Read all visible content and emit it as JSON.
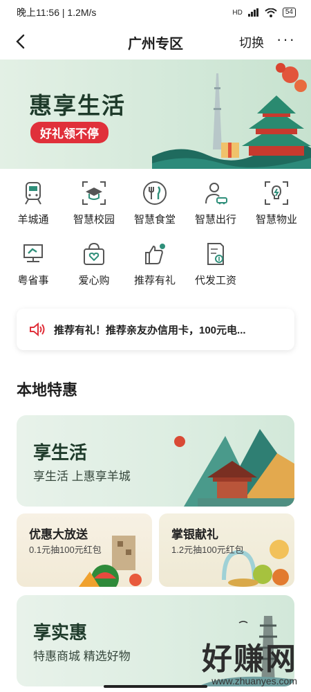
{
  "status": {
    "time": "晚上11:56",
    "speed": "1.2M/s",
    "network": "HD",
    "battery": "54"
  },
  "nav": {
    "title": "广州专区",
    "switch_label": "切换",
    "more_label": "···"
  },
  "banner": {
    "title": "惠享生活",
    "tag": "好礼领不停"
  },
  "grid": [
    {
      "label": "羊城通",
      "icon": "metro-icon"
    },
    {
      "label": "智慧校园",
      "icon": "graduation-cap-icon"
    },
    {
      "label": "智慧食堂",
      "icon": "fork-knife-icon"
    },
    {
      "label": "智慧出行",
      "icon": "person-car-icon"
    },
    {
      "label": "智慧物业",
      "icon": "lightbulb-icon"
    },
    {
      "label": "粤省事",
      "icon": "screen-icon"
    },
    {
      "label": "爱心购",
      "icon": "shopping-basket-heart-icon"
    },
    {
      "label": "推荐有礼",
      "icon": "thumbs-up-icon"
    },
    {
      "label": "代发工资",
      "icon": "payroll-document-icon"
    }
  ],
  "notice": {
    "text": "推荐有礼！推荐亲友办信用卡，100元电..."
  },
  "section": {
    "title": "本地特惠",
    "cards": {
      "life": {
        "title": "享生活",
        "subtitle": "享生活 上惠享羊城"
      },
      "discount": {
        "title": "优惠大放送",
        "subtitle": "0.1元抽100元红包"
      },
      "gift": {
        "title": "掌银献礼",
        "subtitle": "1.2元抽100元红包"
      },
      "benefit": {
        "title": "享实惠",
        "subtitle": "特惠商城 精选好物"
      }
    }
  },
  "watermark": {
    "brand": "好赚网",
    "url": "www.zhuanyes.com"
  },
  "colors": {
    "accent_red": "#e0303a",
    "banner_green": "#d4e9da",
    "icon_teal": "#2f8f7a"
  }
}
